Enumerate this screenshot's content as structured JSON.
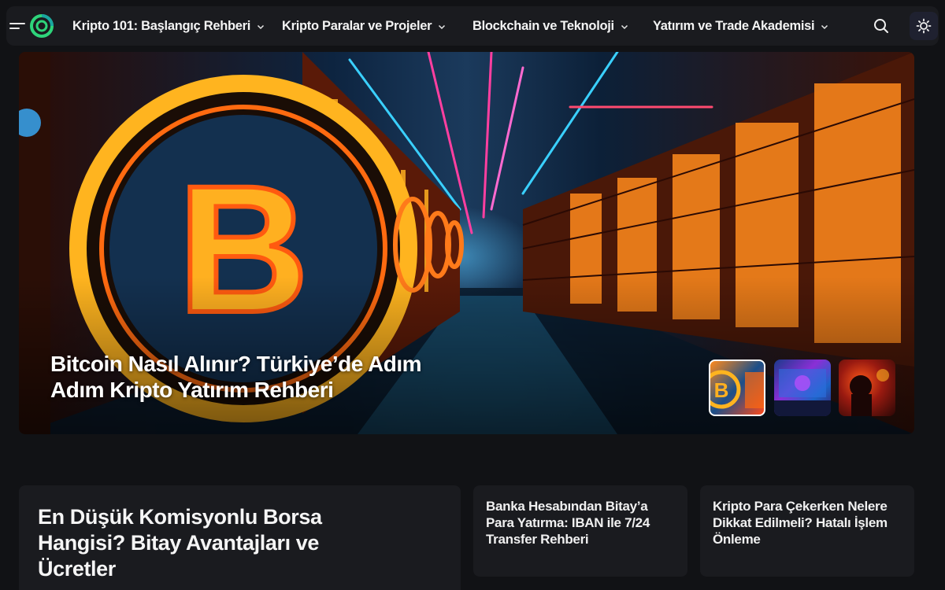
{
  "nav": {
    "items": [
      {
        "label": "Kripto 101: Başlangıç Rehberi"
      },
      {
        "label": "Kripto Paralar ve Projeler"
      },
      {
        "label": "Blockchain ve Teknoloji"
      },
      {
        "label": "Yatırım ve Trade Akademisi"
      }
    ],
    "icons": [
      "menu-icon",
      "logo-icon",
      "chevron-down-icon",
      "search-icon",
      "sun-icon"
    ],
    "colors": {
      "logo_green": "#2ed47a",
      "logo_teal": "#1aa6a0",
      "theme_btn_bg": "#1f2130"
    }
  },
  "hero": {
    "title": "Bitcoin Nasıl Alınır? Türkiye’de Adım Adım Kripto Yatırım Rehberi",
    "thumbnails": [
      {
        "active": true
      },
      {
        "active": false
      },
      {
        "active": false
      }
    ]
  },
  "cards": {
    "featured": {
      "title": "En Düşük Komisyonlu Borsa Hangisi? Bitay Avantajları ve Ücretler"
    },
    "side": [
      {
        "title": "Banka Hesabından Bitay’a Para Yatırma: IBAN ile 7/24 Transfer Rehberi"
      },
      {
        "title": "Kripto Para Çekerken Nelere Dikkat Edilmeli? Hatalı İşlem Önleme"
      }
    ]
  },
  "colors": {
    "page_bg": "#111215",
    "card_bg": "#1a1b1f",
    "text": "#f2f2f2"
  }
}
